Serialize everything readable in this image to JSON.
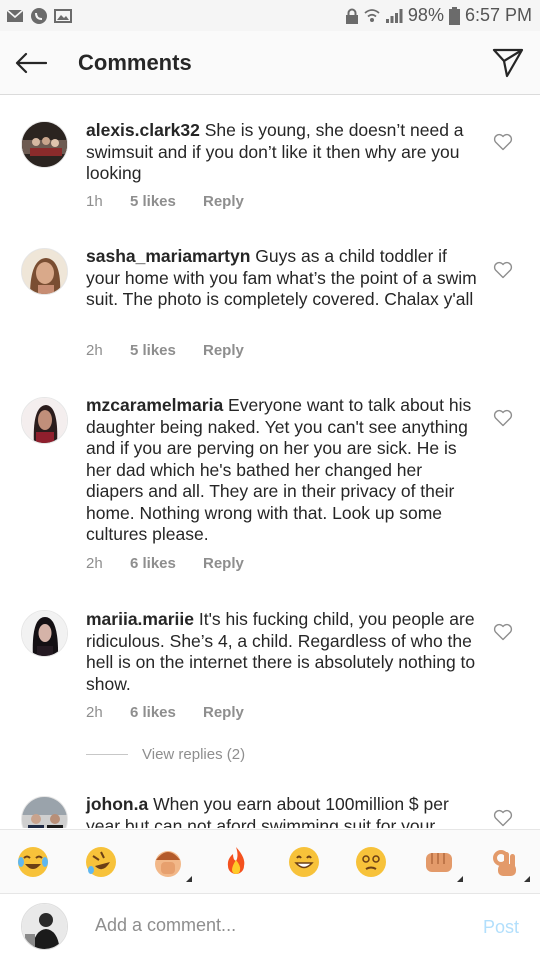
{
  "status_bar": {
    "battery": "98%",
    "time": "6:57 PM"
  },
  "header": {
    "title": "Comments"
  },
  "comments": [
    {
      "username": "alexis.clark32",
      "text": " She is young, she doesn’t need a swimsuit and if you don’t like it then why are you looking",
      "time": "1h",
      "likes": "5 likes",
      "reply": "Reply"
    },
    {
      "username": "sasha_mariamartyn",
      "text": " Guys as a child toddler if your home with you fam what’s the point of a swim suit. The photo is completely covered. Chalax y'all",
      "time": "2h",
      "likes": "5 likes",
      "reply": "Reply"
    },
    {
      "username": "mzcaramelmaria",
      "text": " Everyone want to talk about his daughter being naked. Yet you can't see anything and if you are perving on her you are sick. He is her dad which he's bathed her changed her diapers and all. They are in their privacy of their home. Nothing wrong with that. Look up some cultures please.",
      "time": "2h",
      "likes": "6 likes",
      "reply": "Reply"
    },
    {
      "username": "mariia.mariie",
      "text": " It's his fucking child, you people are ridiculous. She’s 4, a child. Regardless of who the hell is on the internet there is absolutely nothing to show.",
      "time": "2h",
      "likes": "6 likes",
      "reply": "Reply"
    },
    {
      "username": "johon.a",
      "text": " When you earn about 100million $ per year but can not aford swimming suit for your"
    }
  ],
  "view_replies": "View replies (2)",
  "emoji_bar": [
    "face-with-tears-of-joy",
    "rolling-on-floor-laughing",
    "face-palm",
    "fire",
    "grinning-face",
    "dizzy-face",
    "oncoming-fist",
    "ok-hand"
  ],
  "composer": {
    "placeholder": "Add a comment...",
    "post_label": "Post"
  },
  "colors": {
    "link_disabled": "#b2dffc",
    "meta_gray": "#8e8e8e",
    "text": "#262626"
  }
}
